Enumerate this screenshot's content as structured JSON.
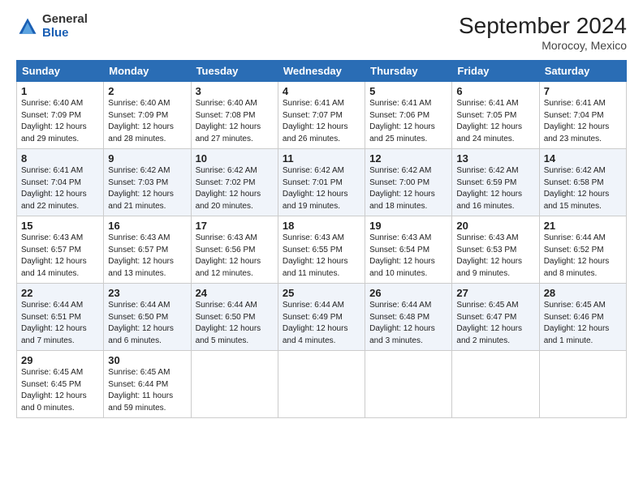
{
  "logo": {
    "general": "General",
    "blue": "Blue"
  },
  "title": "September 2024",
  "location": "Morocoy, Mexico",
  "days_of_week": [
    "Sunday",
    "Monday",
    "Tuesday",
    "Wednesday",
    "Thursday",
    "Friday",
    "Saturday"
  ],
  "weeks": [
    [
      {
        "day": "1",
        "sunrise": "6:40 AM",
        "sunset": "7:09 PM",
        "daylight": "12 hours and 29 minutes."
      },
      {
        "day": "2",
        "sunrise": "6:40 AM",
        "sunset": "7:09 PM",
        "daylight": "12 hours and 28 minutes."
      },
      {
        "day": "3",
        "sunrise": "6:40 AM",
        "sunset": "7:08 PM",
        "daylight": "12 hours and 27 minutes."
      },
      {
        "day": "4",
        "sunrise": "6:41 AM",
        "sunset": "7:07 PM",
        "daylight": "12 hours and 26 minutes."
      },
      {
        "day": "5",
        "sunrise": "6:41 AM",
        "sunset": "7:06 PM",
        "daylight": "12 hours and 25 minutes."
      },
      {
        "day": "6",
        "sunrise": "6:41 AM",
        "sunset": "7:05 PM",
        "daylight": "12 hours and 24 minutes."
      },
      {
        "day": "7",
        "sunrise": "6:41 AM",
        "sunset": "7:04 PM",
        "daylight": "12 hours and 23 minutes."
      }
    ],
    [
      {
        "day": "8",
        "sunrise": "6:41 AM",
        "sunset": "7:04 PM",
        "daylight": "12 hours and 22 minutes."
      },
      {
        "day": "9",
        "sunrise": "6:42 AM",
        "sunset": "7:03 PM",
        "daylight": "12 hours and 21 minutes."
      },
      {
        "day": "10",
        "sunrise": "6:42 AM",
        "sunset": "7:02 PM",
        "daylight": "12 hours and 20 minutes."
      },
      {
        "day": "11",
        "sunrise": "6:42 AM",
        "sunset": "7:01 PM",
        "daylight": "12 hours and 19 minutes."
      },
      {
        "day": "12",
        "sunrise": "6:42 AM",
        "sunset": "7:00 PM",
        "daylight": "12 hours and 18 minutes."
      },
      {
        "day": "13",
        "sunrise": "6:42 AM",
        "sunset": "6:59 PM",
        "daylight": "12 hours and 16 minutes."
      },
      {
        "day": "14",
        "sunrise": "6:42 AM",
        "sunset": "6:58 PM",
        "daylight": "12 hours and 15 minutes."
      }
    ],
    [
      {
        "day": "15",
        "sunrise": "6:43 AM",
        "sunset": "6:57 PM",
        "daylight": "12 hours and 14 minutes."
      },
      {
        "day": "16",
        "sunrise": "6:43 AM",
        "sunset": "6:57 PM",
        "daylight": "12 hours and 13 minutes."
      },
      {
        "day": "17",
        "sunrise": "6:43 AM",
        "sunset": "6:56 PM",
        "daylight": "12 hours and 12 minutes."
      },
      {
        "day": "18",
        "sunrise": "6:43 AM",
        "sunset": "6:55 PM",
        "daylight": "12 hours and 11 minutes."
      },
      {
        "day": "19",
        "sunrise": "6:43 AM",
        "sunset": "6:54 PM",
        "daylight": "12 hours and 10 minutes."
      },
      {
        "day": "20",
        "sunrise": "6:43 AM",
        "sunset": "6:53 PM",
        "daylight": "12 hours and 9 minutes."
      },
      {
        "day": "21",
        "sunrise": "6:44 AM",
        "sunset": "6:52 PM",
        "daylight": "12 hours and 8 minutes."
      }
    ],
    [
      {
        "day": "22",
        "sunrise": "6:44 AM",
        "sunset": "6:51 PM",
        "daylight": "12 hours and 7 minutes."
      },
      {
        "day": "23",
        "sunrise": "6:44 AM",
        "sunset": "6:50 PM",
        "daylight": "12 hours and 6 minutes."
      },
      {
        "day": "24",
        "sunrise": "6:44 AM",
        "sunset": "6:50 PM",
        "daylight": "12 hours and 5 minutes."
      },
      {
        "day": "25",
        "sunrise": "6:44 AM",
        "sunset": "6:49 PM",
        "daylight": "12 hours and 4 minutes."
      },
      {
        "day": "26",
        "sunrise": "6:44 AM",
        "sunset": "6:48 PM",
        "daylight": "12 hours and 3 minutes."
      },
      {
        "day": "27",
        "sunrise": "6:45 AM",
        "sunset": "6:47 PM",
        "daylight": "12 hours and 2 minutes."
      },
      {
        "day": "28",
        "sunrise": "6:45 AM",
        "sunset": "6:46 PM",
        "daylight": "12 hours and 1 minute."
      }
    ],
    [
      {
        "day": "29",
        "sunrise": "6:45 AM",
        "sunset": "6:45 PM",
        "daylight": "12 hours and 0 minutes."
      },
      {
        "day": "30",
        "sunrise": "6:45 AM",
        "sunset": "6:44 PM",
        "daylight": "11 hours and 59 minutes."
      },
      null,
      null,
      null,
      null,
      null
    ]
  ]
}
